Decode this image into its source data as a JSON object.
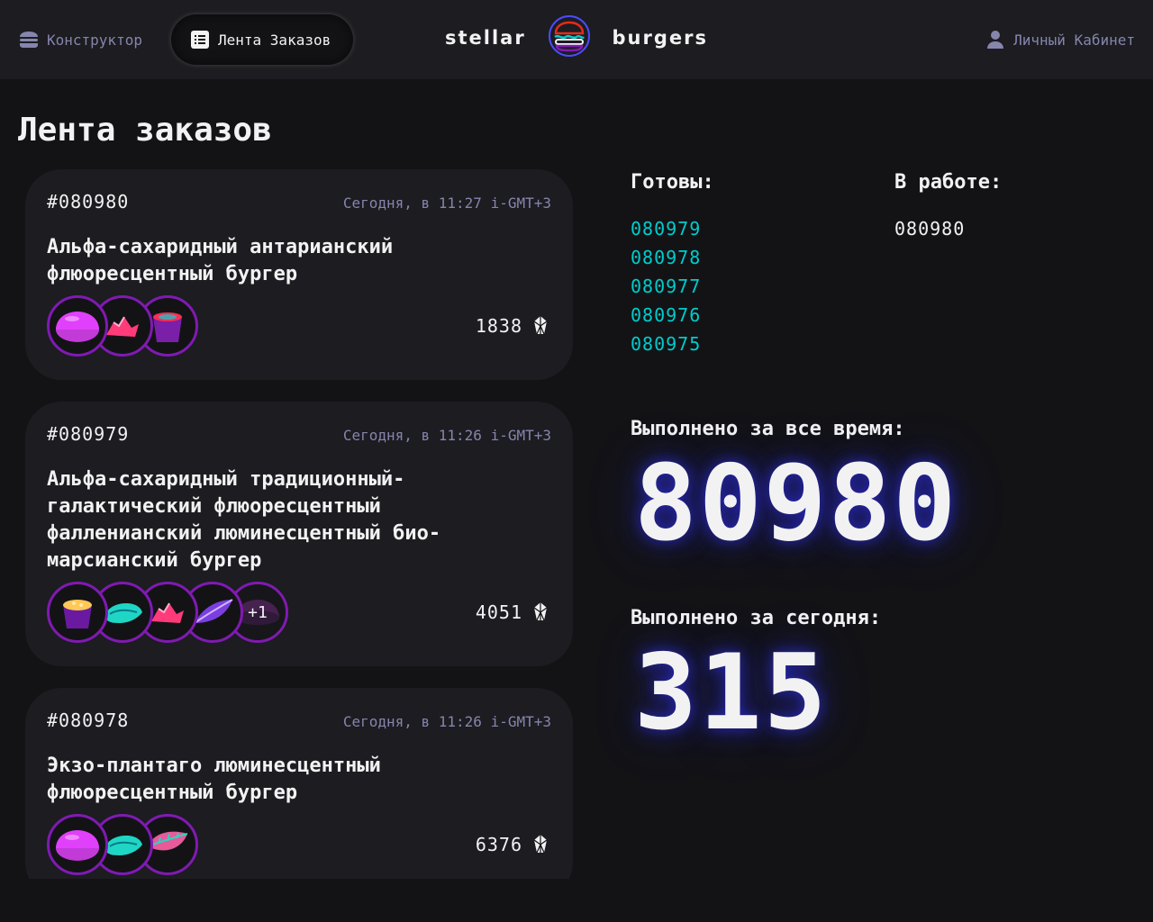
{
  "header": {
    "nav_constructor": "Конструктор",
    "nav_feed": "Лента Заказов",
    "nav_account": "Личный Кабинет",
    "logo_left": "stellar",
    "logo_right": "burgers"
  },
  "page": {
    "title": "Лента заказов"
  },
  "orders": [
    {
      "number": "#080980",
      "time": "Сегодня, в 11:27 i-GMT+3",
      "name": "Альфа-сахаридный антарианский флюоресцентный бургер",
      "price": "1838",
      "ingredients": [
        "bun-purple-icon",
        "crystal-meat-icon",
        "sauce-red-icon"
      ],
      "more": ""
    },
    {
      "number": "#080979",
      "time": "Сегодня, в 11:26 i-GMT+3",
      "name": "Альфа-сахаридный традиционный-галактический флюоресцентный фалленианский люминесцентный био-марсианский бургер",
      "price": "4051",
      "ingredients": [
        "sauce-cheese-icon",
        "meat-teal-icon",
        "crystal-meat-icon",
        "leaf-blade-icon",
        "bun-dark-icon"
      ],
      "more": "+1"
    },
    {
      "number": "#080978",
      "time": "Сегодня, в 11:26 i-GMT+3",
      "name": "Экзо-плантаго люминесцентный флюоресцентный бургер",
      "price": "6376",
      "ingredients": [
        "bun-purple-icon",
        "meat-teal-icon",
        "leaf-plant-icon"
      ],
      "more": ""
    }
  ],
  "stats": {
    "ready_title": "Готовы:",
    "in_work_title": "В работе:",
    "ready": [
      "080979",
      "080978",
      "080977",
      "080976",
      "080975"
    ],
    "in_work": [
      "080980"
    ],
    "total_label": "Выполнено за все время:",
    "total_value": "80980",
    "today_label": "Выполнено за сегодня:",
    "today_value": "315"
  },
  "colors": {
    "background": "#131316",
    "surface": "#1c1c21",
    "accent_ready": "#00cccc",
    "inactive": "#8585ad",
    "ingredient_border": "#801ab2",
    "glow": "#3333ff"
  }
}
